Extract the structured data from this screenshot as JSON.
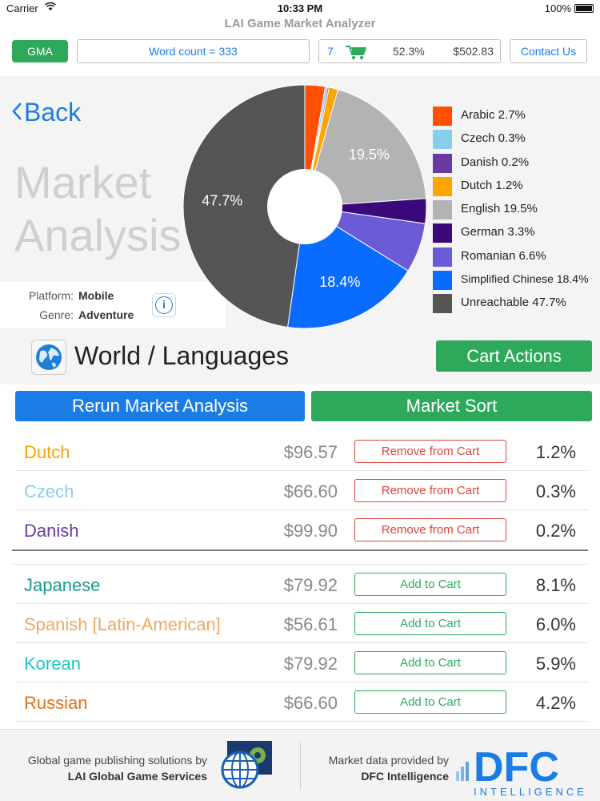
{
  "status_bar": {
    "carrier": "Carrier",
    "time": "10:33 PM",
    "battery": "100%"
  },
  "app_title": "LAI Game Market Analyzer",
  "toolbar": {
    "gma_label": "GMA",
    "word_count": "Word count = 333",
    "cart_count": "7",
    "cart_percent": "52.3%",
    "cart_total": "$502.83",
    "contact_label": "Contact Us"
  },
  "nav": {
    "back_label": "Back"
  },
  "page_title_line1": "Market",
  "page_title_line2": "Analysis",
  "info": {
    "platform_label": "Platform:",
    "platform_value": "Mobile",
    "genre_label": "Genre:",
    "genre_value": "Adventure",
    "info_glyph": "i"
  },
  "chart_data": {
    "type": "pie",
    "donut": true,
    "slices": [
      {
        "label": "Arabic",
        "value": 2.7,
        "color": "#ff4f00"
      },
      {
        "label": "Czech",
        "value": 0.3,
        "color": "#87ceeb"
      },
      {
        "label": "Danish",
        "value": 0.2,
        "color": "#6a3aa0"
      },
      {
        "label": "Dutch",
        "value": 1.2,
        "color": "#ffa500"
      },
      {
        "label": "English",
        "value": 19.5,
        "color": "#b3b3b3"
      },
      {
        "label": "German",
        "value": 3.3,
        "color": "#3b0a7a"
      },
      {
        "label": "Romanian",
        "value": 6.6,
        "color": "#6b5bd6"
      },
      {
        "label": "Simplified Chinese",
        "value": 18.4,
        "color": "#0a6cff"
      },
      {
        "label": "Unreachable",
        "value": 47.7,
        "color": "#555555"
      }
    ],
    "slice_labels": [
      "19.5%",
      "18.4%",
      "47.7%"
    ],
    "legend": [
      "Arabic 2.7%",
      "Czech 0.3%",
      "Danish 0.2%",
      "Dutch 1.2%",
      "English 19.5%",
      "German 3.3%",
      "Romanian 6.6%",
      "Simplified Chinese 18.4%",
      "Unreachable 47.7%"
    ],
    "legend_position": "right"
  },
  "section": {
    "title": "World / Languages",
    "cart_actions_label": "Cart Actions"
  },
  "actions": {
    "rerun_label": "Rerun Market Analysis",
    "sort_label": "Market Sort"
  },
  "in_cart": [
    {
      "name": "Dutch",
      "price": "$96.57",
      "action": "Remove from Cart",
      "share": "1.2%",
      "color": "#f5a300"
    },
    {
      "name": "Czech",
      "price": "$66.60",
      "action": "Remove from Cart",
      "share": "0.3%",
      "color": "#87ceeb"
    },
    {
      "name": "Danish",
      "price": "$99.90",
      "action": "Remove from Cart",
      "share": "0.2%",
      "color": "#6a3aa0"
    }
  ],
  "available": [
    {
      "name": "Japanese",
      "price": "$79.92",
      "action": "Add to Cart",
      "share": "8.1%",
      "color": "#1a9a8a"
    },
    {
      "name": "Spanish [Latin-American]",
      "price": "$56.61",
      "action": "Add to Cart",
      "share": "6.0%",
      "color": "#f0a860"
    },
    {
      "name": "Korean",
      "price": "$79.92",
      "action": "Add to Cart",
      "share": "5.9%",
      "color": "#1ec4c4"
    },
    {
      "name": "Russian",
      "price": "$66.60",
      "action": "Add to Cart",
      "share": "4.2%",
      "color": "#e0701a"
    }
  ],
  "footer": {
    "lai_text": "Global game publishing solutions by",
    "lai_name": "LAI Global Game Services",
    "dfc_text": "Market data provided by",
    "dfc_name": "DFC Intelligence",
    "dfc_logo_main": "DFC",
    "dfc_logo_sub": "INTELLIGENCE"
  }
}
